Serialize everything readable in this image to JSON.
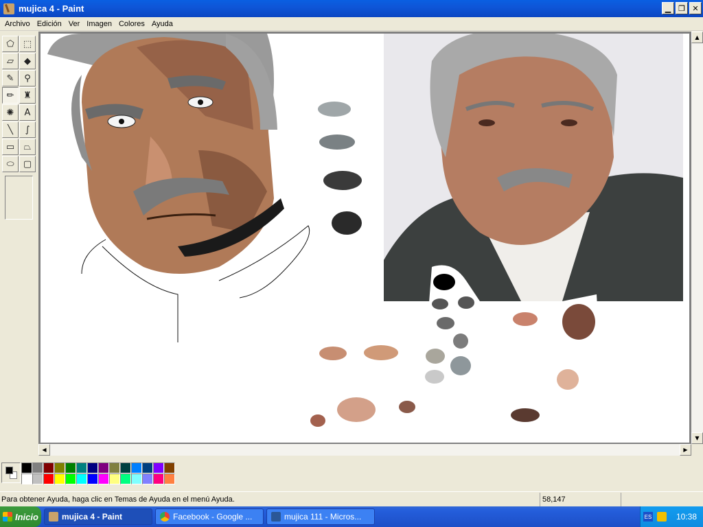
{
  "window": {
    "title": "mujica 4 - Paint"
  },
  "menu": [
    "Archivo",
    "Edición",
    "Ver",
    "Imagen",
    "Colores",
    "Ayuda"
  ],
  "tools": [
    {
      "name": "free-select-tool",
      "glyph": "⬠"
    },
    {
      "name": "rect-select-tool",
      "glyph": "⬚"
    },
    {
      "name": "eraser-tool",
      "glyph": "▱"
    },
    {
      "name": "fill-tool",
      "glyph": "◆"
    },
    {
      "name": "color-picker-tool",
      "glyph": "✎"
    },
    {
      "name": "magnifier-tool",
      "glyph": "⚲"
    },
    {
      "name": "pencil-tool",
      "glyph": "✏"
    },
    {
      "name": "brush-tool",
      "glyph": "♜"
    },
    {
      "name": "airbrush-tool",
      "glyph": "✺"
    },
    {
      "name": "text-tool",
      "glyph": "A"
    },
    {
      "name": "line-tool",
      "glyph": "╲"
    },
    {
      "name": "curve-tool",
      "glyph": "∫"
    },
    {
      "name": "rectangle-tool",
      "glyph": "▭"
    },
    {
      "name": "polygon-tool",
      "glyph": "⏢"
    },
    {
      "name": "ellipse-tool",
      "glyph": "⬭"
    },
    {
      "name": "rounded-rect-tool",
      "glyph": "▢"
    }
  ],
  "palette": [
    "#000000",
    "#808080",
    "#800000",
    "#808000",
    "#008000",
    "#008080",
    "#000080",
    "#800080",
    "#808040",
    "#004040",
    "#0080ff",
    "#004080",
    "#8000ff",
    "#804000",
    "#ffffff",
    "#c0c0c0",
    "#ff0000",
    "#ffff00",
    "#00ff00",
    "#00ffff",
    "#0000ff",
    "#ff00ff",
    "#ffff80",
    "#00ff80",
    "#80ffff",
    "#8080ff",
    "#ff0080",
    "#ff8040"
  ],
  "status": {
    "help": "Para obtener Ayuda, haga clic en Temas de Ayuda en el menú Ayuda.",
    "coords": "58,147"
  },
  "taskbar": {
    "start": "Inicio",
    "tasks": [
      {
        "label": "mujica 4 - Paint",
        "icon_color": "#c9a36a"
      },
      {
        "label": "Facebook - Google ...",
        "icon_color": "#e94235"
      },
      {
        "label": "mujica 111 - Micros...",
        "icon_color": "#2b5797"
      }
    ],
    "lang": "ES",
    "clock": "10:38"
  }
}
